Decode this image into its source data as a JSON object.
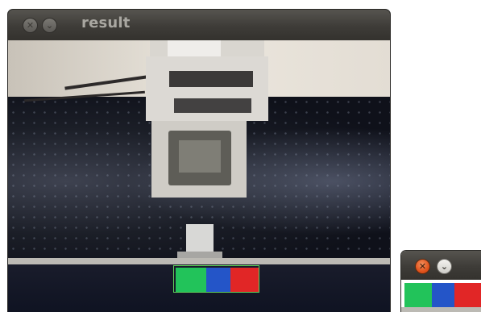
{
  "windows": {
    "main": {
      "title": "result"
    },
    "small": {
      "title": ""
    }
  },
  "icons": {
    "close": "close-icon",
    "minimize": "chevron-down-icon"
  },
  "colors": {
    "titlebar": "#3e3c38",
    "title_text": "#a9a7a1",
    "roi_outline": "#5fd35b",
    "green_patch": "#22c35a",
    "blue_patch": "#2455c8",
    "red_patch": "#e12626"
  },
  "glyphs": {
    "close": "✕",
    "minimize": "⌄"
  }
}
